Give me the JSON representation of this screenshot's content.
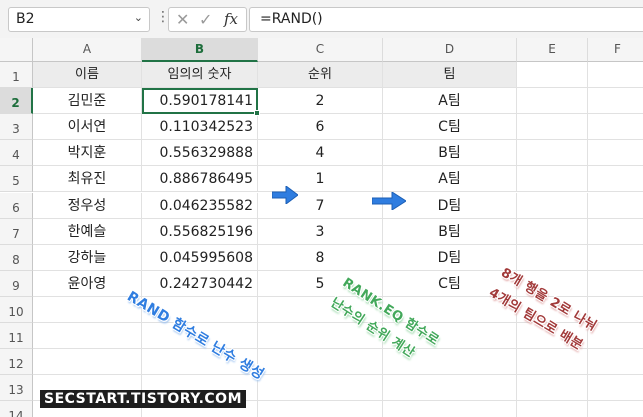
{
  "formula_bar": {
    "name_box": "B2",
    "name_box_caret": "⌄",
    "more_icon": "⋮",
    "cancel_glyph": "✕",
    "enter_glyph": "✓",
    "fx_glyph": "fx",
    "formula": "=RAND()"
  },
  "columns": [
    "A",
    "B",
    "C",
    "D",
    "E",
    "F"
  ],
  "rows": [
    "1",
    "2",
    "3",
    "4",
    "5",
    "6",
    "7",
    "8",
    "9",
    "10",
    "11",
    "12",
    "13",
    "14"
  ],
  "active_cell": {
    "column": "B",
    "row": "2"
  },
  "table": {
    "headers": [
      "이름",
      "임의의 숫자",
      "순위",
      "팀"
    ],
    "rows": [
      [
        "김민준",
        "0.590178141",
        "2",
        "A팀"
      ],
      [
        "이서연",
        "0.110342523",
        "6",
        "C팀"
      ],
      [
        "박지훈",
        "0.556329888",
        "4",
        "B팀"
      ],
      [
        "최유진",
        "0.886786495",
        "1",
        "A팀"
      ],
      [
        "정우성",
        "0.046235582",
        "7",
        "D팀"
      ],
      [
        "한예슬",
        "0.556825196",
        "3",
        "B팀"
      ],
      [
        "강하늘",
        "0.045995608",
        "8",
        "D팀"
      ],
      [
        "윤아영",
        "0.242730442",
        "5",
        "C팀"
      ]
    ]
  },
  "annotations": {
    "rand": "RAND 함수로 난수 생성",
    "rank_line1": "RANK.EQ 함수로",
    "rank_line2": "난수의 순위 계산",
    "team_line1": "8개 행을 2로 나눠",
    "team_line2": "4개의 팀으로 배분"
  },
  "watermark": "SECSTART.TISTORY.COM",
  "colors": {
    "accent_green": "#217346",
    "arrow_blue": "#2f7de0"
  }
}
